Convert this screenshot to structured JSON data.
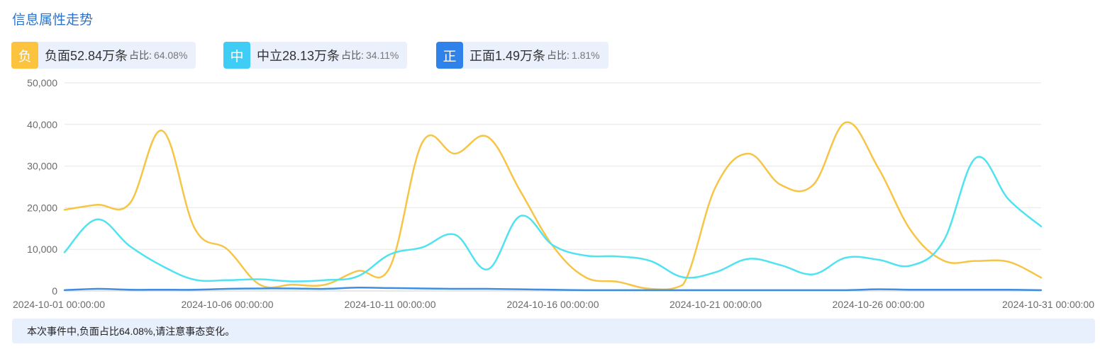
{
  "title": "信息属性走势",
  "legend": [
    {
      "icon": "负",
      "label": "负面52.84万条",
      "ratio_label": "占比:",
      "ratio": "64.08%",
      "color": "#fbc33e"
    },
    {
      "icon": "中",
      "label": "中立28.13万条",
      "ratio_label": "占比:",
      "ratio": "34.11%",
      "color": "#3fcdf5"
    },
    {
      "icon": "正",
      "label": "正面1.49万条",
      "ratio_label": "占比:",
      "ratio": "1.81%",
      "color": "#2e82ea"
    }
  ],
  "note": "本次事件中,负面占比64.08%,请注意事态变化。",
  "chart_data": {
    "type": "line",
    "title": "",
    "xlabel": "",
    "ylabel": "",
    "ylim": [
      0,
      50000
    ],
    "yticks": [
      "0",
      "10,000",
      "20,000",
      "30,000",
      "40,000",
      "50,000"
    ],
    "xtick_labels": [
      "2024-10-01 00:00:00",
      "2024-10-06 00:00:00",
      "2024-10-11 00:00:00",
      "2024-10-16 00:00:00",
      "2024-10-21 00:00:00",
      "2024-10-26 00:00:00",
      "2024-10-31 00:00:00"
    ],
    "grid": true,
    "x": [
      "2024-10-01",
      "2024-10-02",
      "2024-10-03",
      "2024-10-04",
      "2024-10-05",
      "2024-10-06",
      "2024-10-07",
      "2024-10-08",
      "2024-10-09",
      "2024-10-10",
      "2024-10-11",
      "2024-10-12",
      "2024-10-13",
      "2024-10-14",
      "2024-10-15",
      "2024-10-16",
      "2024-10-17",
      "2024-10-18",
      "2024-10-19",
      "2024-10-20",
      "2024-10-21",
      "2024-10-22",
      "2024-10-23",
      "2024-10-24",
      "2024-10-25",
      "2024-10-26",
      "2024-10-27",
      "2024-10-28",
      "2024-10-29",
      "2024-10-30",
      "2024-10-31"
    ],
    "series": [
      {
        "color": "#f7c545",
        "values": [
          19500,
          20700,
          21000,
          38500,
          15000,
          10000,
          1500,
          1500,
          1500,
          4800,
          5800,
          35800,
          33000,
          37000,
          24000,
          10800,
          3300,
          2200,
          500,
          1500,
          25000,
          33000,
          25500,
          25500,
          40500,
          29500,
          14500,
          7300,
          7200,
          7000,
          3200
        ]
      },
      {
        "color": "#4fe3f1",
        "values": [
          9300,
          17200,
          10800,
          6000,
          2700,
          2600,
          2800,
          2300,
          2600,
          3500,
          8800,
          10500,
          13500,
          5200,
          18000,
          11000,
          8500,
          8300,
          7200,
          3300,
          4500,
          7700,
          6200,
          4000,
          8000,
          7500,
          6100,
          12000,
          32000,
          22000,
          15500
        ]
      },
      {
        "color": "#3f8ee0",
        "values": [
          200,
          500,
          300,
          300,
          300,
          500,
          600,
          600,
          500,
          800,
          700,
          600,
          500,
          500,
          400,
          300,
          200,
          200,
          200,
          200,
          200,
          200,
          200,
          200,
          200,
          400,
          300,
          300,
          300,
          300,
          200
        ]
      }
    ]
  }
}
